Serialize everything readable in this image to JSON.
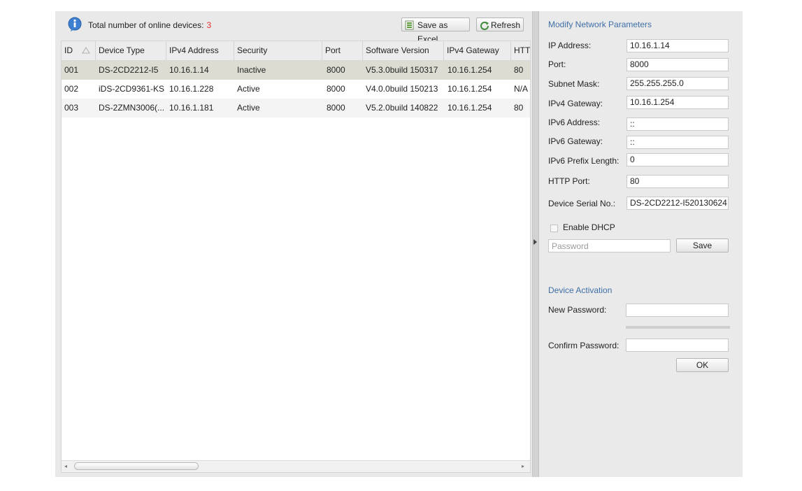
{
  "toolbar": {
    "total_label": "Total number of online devices:",
    "total_count": "3",
    "save_excel_label": "Save as Excel",
    "refresh_label": "Refresh"
  },
  "table": {
    "columns": [
      "ID",
      "Device Type",
      "IPv4 Address",
      "Security",
      "Port",
      "Software Version",
      "IPv4 Gateway",
      "HTT"
    ],
    "rows": [
      [
        "001",
        "DS-2CD2212-I5",
        "10.16.1.14",
        "Inactive",
        "8000",
        "V5.3.0build 150317",
        "10.16.1.254",
        "80"
      ],
      [
        "002",
        "iDS-2CD9361-KS",
        "10.16.1.228",
        "Active",
        "8000",
        "V4.0.0build 150213",
        "10.16.1.254",
        "N/A"
      ],
      [
        "003",
        "DS-2ZMN3006(...",
        "10.16.1.181",
        "Active",
        "8000",
        "V5.2.0build 140822",
        "10.16.1.254",
        "80"
      ]
    ]
  },
  "panel": {
    "title": "Modify Network Parameters",
    "fields": [
      {
        "label": "IP Address:",
        "value": "10.16.1.14"
      },
      {
        "label": "Port:",
        "value": "8000"
      },
      {
        "label": "Subnet Mask:",
        "value": "255.255.255.0"
      },
      {
        "label": "IPv4 Gateway:",
        "value": "10.16.1.254"
      },
      {
        "label": "IPv6 Address:",
        "value": "::"
      },
      {
        "label": "IPv6 Gateway:",
        "value": "::"
      },
      {
        "label": "IPv6 Prefix Length:",
        "value": "0"
      },
      {
        "label": "HTTP Port:",
        "value": "80"
      },
      {
        "label": "Device Serial No.:",
        "value": "DS-2CD2212-I520130624"
      }
    ],
    "dhcp_label": "Enable DHCP",
    "password_placeholder": "Password",
    "save_label": "Save"
  },
  "activation": {
    "title": "Device Activation",
    "new_password_label": "New Password:",
    "confirm_password_label": "Confirm Password:",
    "ok_label": "OK"
  }
}
